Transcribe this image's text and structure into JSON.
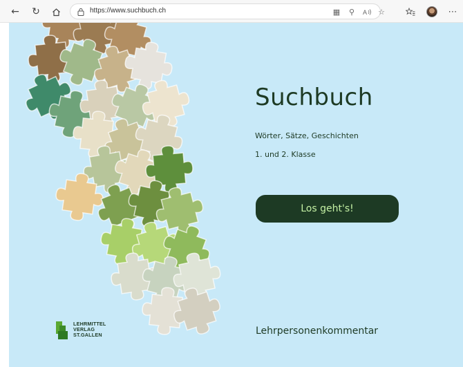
{
  "browser": {
    "url": "https://www.suchbuch.ch",
    "icons": {
      "back": "arrow-left-icon",
      "refresh": "refresh-icon",
      "home": "home-icon",
      "lock": "lock-icon",
      "reader": "reader-mode-icon",
      "zoom": "zoom-icon",
      "read_aloud": "read-aloud-icon",
      "favorite": "star-icon",
      "favorites": "favorites-icon",
      "more": "more-icon"
    }
  },
  "page": {
    "title": "Suchbuch",
    "subtitle": "Wörter, Sätze, Geschichten",
    "grade": "1. und 2. Klasse",
    "cta_label": "Los geht's!",
    "teacher_link": "Lehrpersonenkommentar",
    "publisher": {
      "line1": "LEHRMITTEL",
      "line2": "VERLAG",
      "line3": "ST.GALLEN"
    }
  },
  "colors": {
    "page_background": "#c8e9f8",
    "accent_dark_green": "#1d3a24",
    "button_text": "#c4f0a4",
    "logo_green": "#5aa832"
  }
}
